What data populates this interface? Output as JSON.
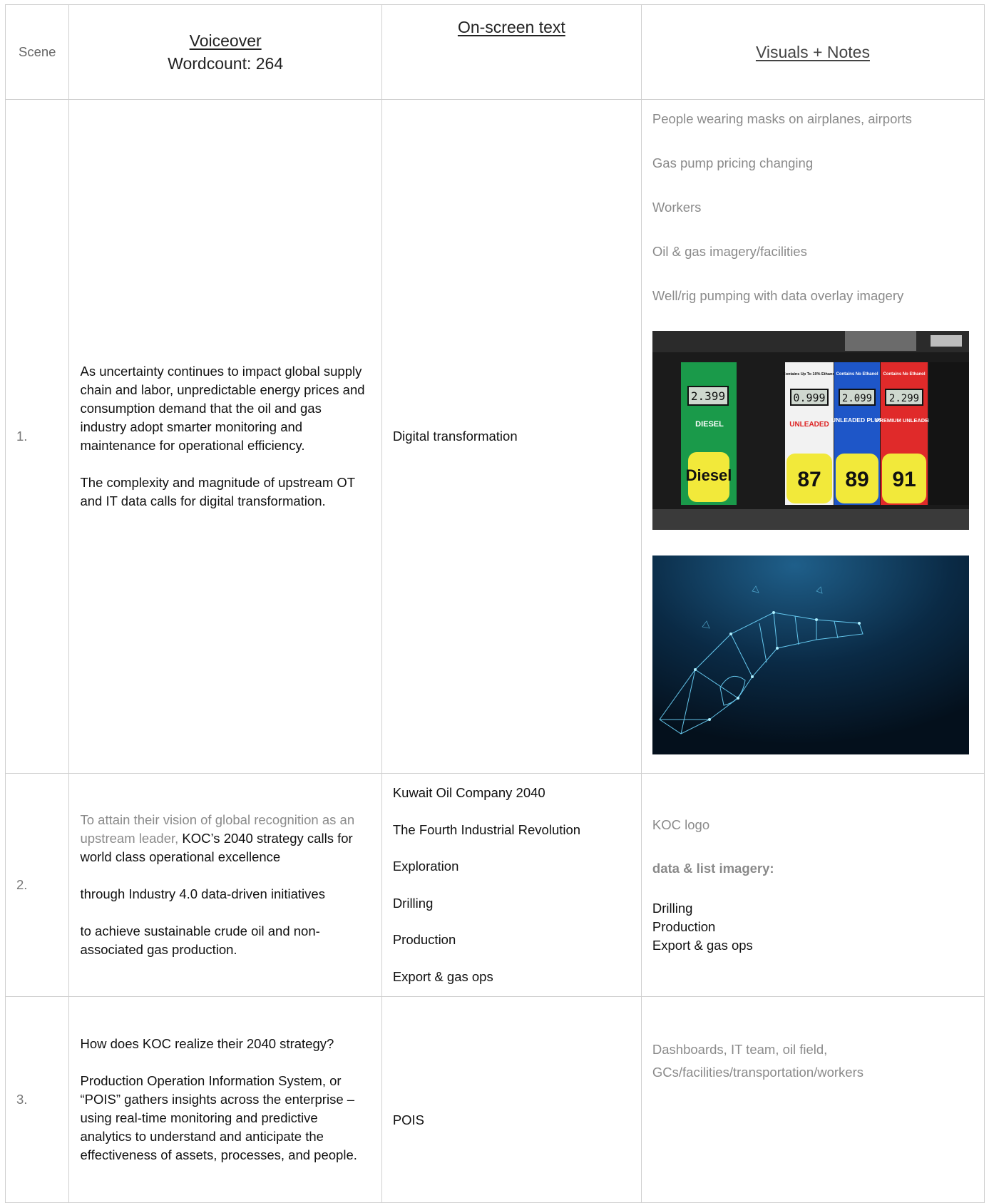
{
  "header": {
    "scene": "Scene",
    "voiceover": "Voiceover",
    "wordcount": "Wordcount: 264",
    "onscreen": "On-screen text",
    "visuals": "Visuals + Notes"
  },
  "rows": [
    {
      "scene": "1.",
      "voiceover_1": "As uncertainty continues to impact global supply chain and labor, unpredictable energy prices and consumption demand that the oil and gas industry adopt smarter monitoring and maintenance for operational efficiency.",
      "voiceover_2": "The complexity and magnitude of upstream OT and IT data calls for digital transformation.",
      "onscreen": "Digital transformation",
      "visual_notes": [
        "People wearing masks on airplanes, airports",
        "Gas pump pricing changing",
        "Workers",
        "Oil & gas imagery/facilities",
        "Well/rig pumping with data overlay imagery"
      ],
      "pump_image": {
        "panels": [
          {
            "price": "2.399",
            "label": "DIESEL",
            "grade": "Diesel",
            "color": "#1a9a4a"
          },
          {
            "price": "0.999",
            "label": "UNLEADED",
            "grade": "87",
            "color": "#f2f2f2",
            "top": "Contains Up To 10% Ethanol"
          },
          {
            "price": "2.099",
            "label": "UNLEADED PLUS",
            "grade": "89",
            "color": "#1e56c8",
            "top": "Contains No Ethanol"
          },
          {
            "price": "2.299",
            "label": "PREMIUM UNLEADED",
            "grade": "91",
            "color": "#e02a2a",
            "top": "Contains No Ethanol"
          }
        ]
      }
    },
    {
      "scene": "2.",
      "voiceover_a_grey": "To attain their vision of global recognition as an upstream leader,",
      "voiceover_a_black": " KOC’s 2040 strategy calls for world class operational excellence",
      "voiceover_b": "through Industry 4.0 data-driven initiatives",
      "voiceover_c": "to achieve sustainable crude oil and non-associated gas production.",
      "onscreen": [
        "Kuwait Oil Company 2040",
        "The Fourth Industrial Revolution",
        "Exploration",
        "Drilling",
        "Production",
        "Export & gas ops"
      ],
      "visual_note_1": "KOC logo",
      "visual_note_2": "data & list imagery:",
      "visual_list": [
        "Drilling",
        "Production",
        "Export & gas ops"
      ]
    },
    {
      "scene": "3.",
      "voiceover_1": "How does KOC realize their 2040 strategy?",
      "voiceover_2": "Production Operation Information System, or “POIS” gathers insights across the enterprise – using real-time monitoring and predictive analytics to understand and anticipate the effectiveness of assets, processes, and people.",
      "onscreen": "POIS",
      "visual_notes": [
        "Dashboards, IT team, oil field,",
        "GCs/facilities/transportation/workers"
      ]
    }
  ]
}
